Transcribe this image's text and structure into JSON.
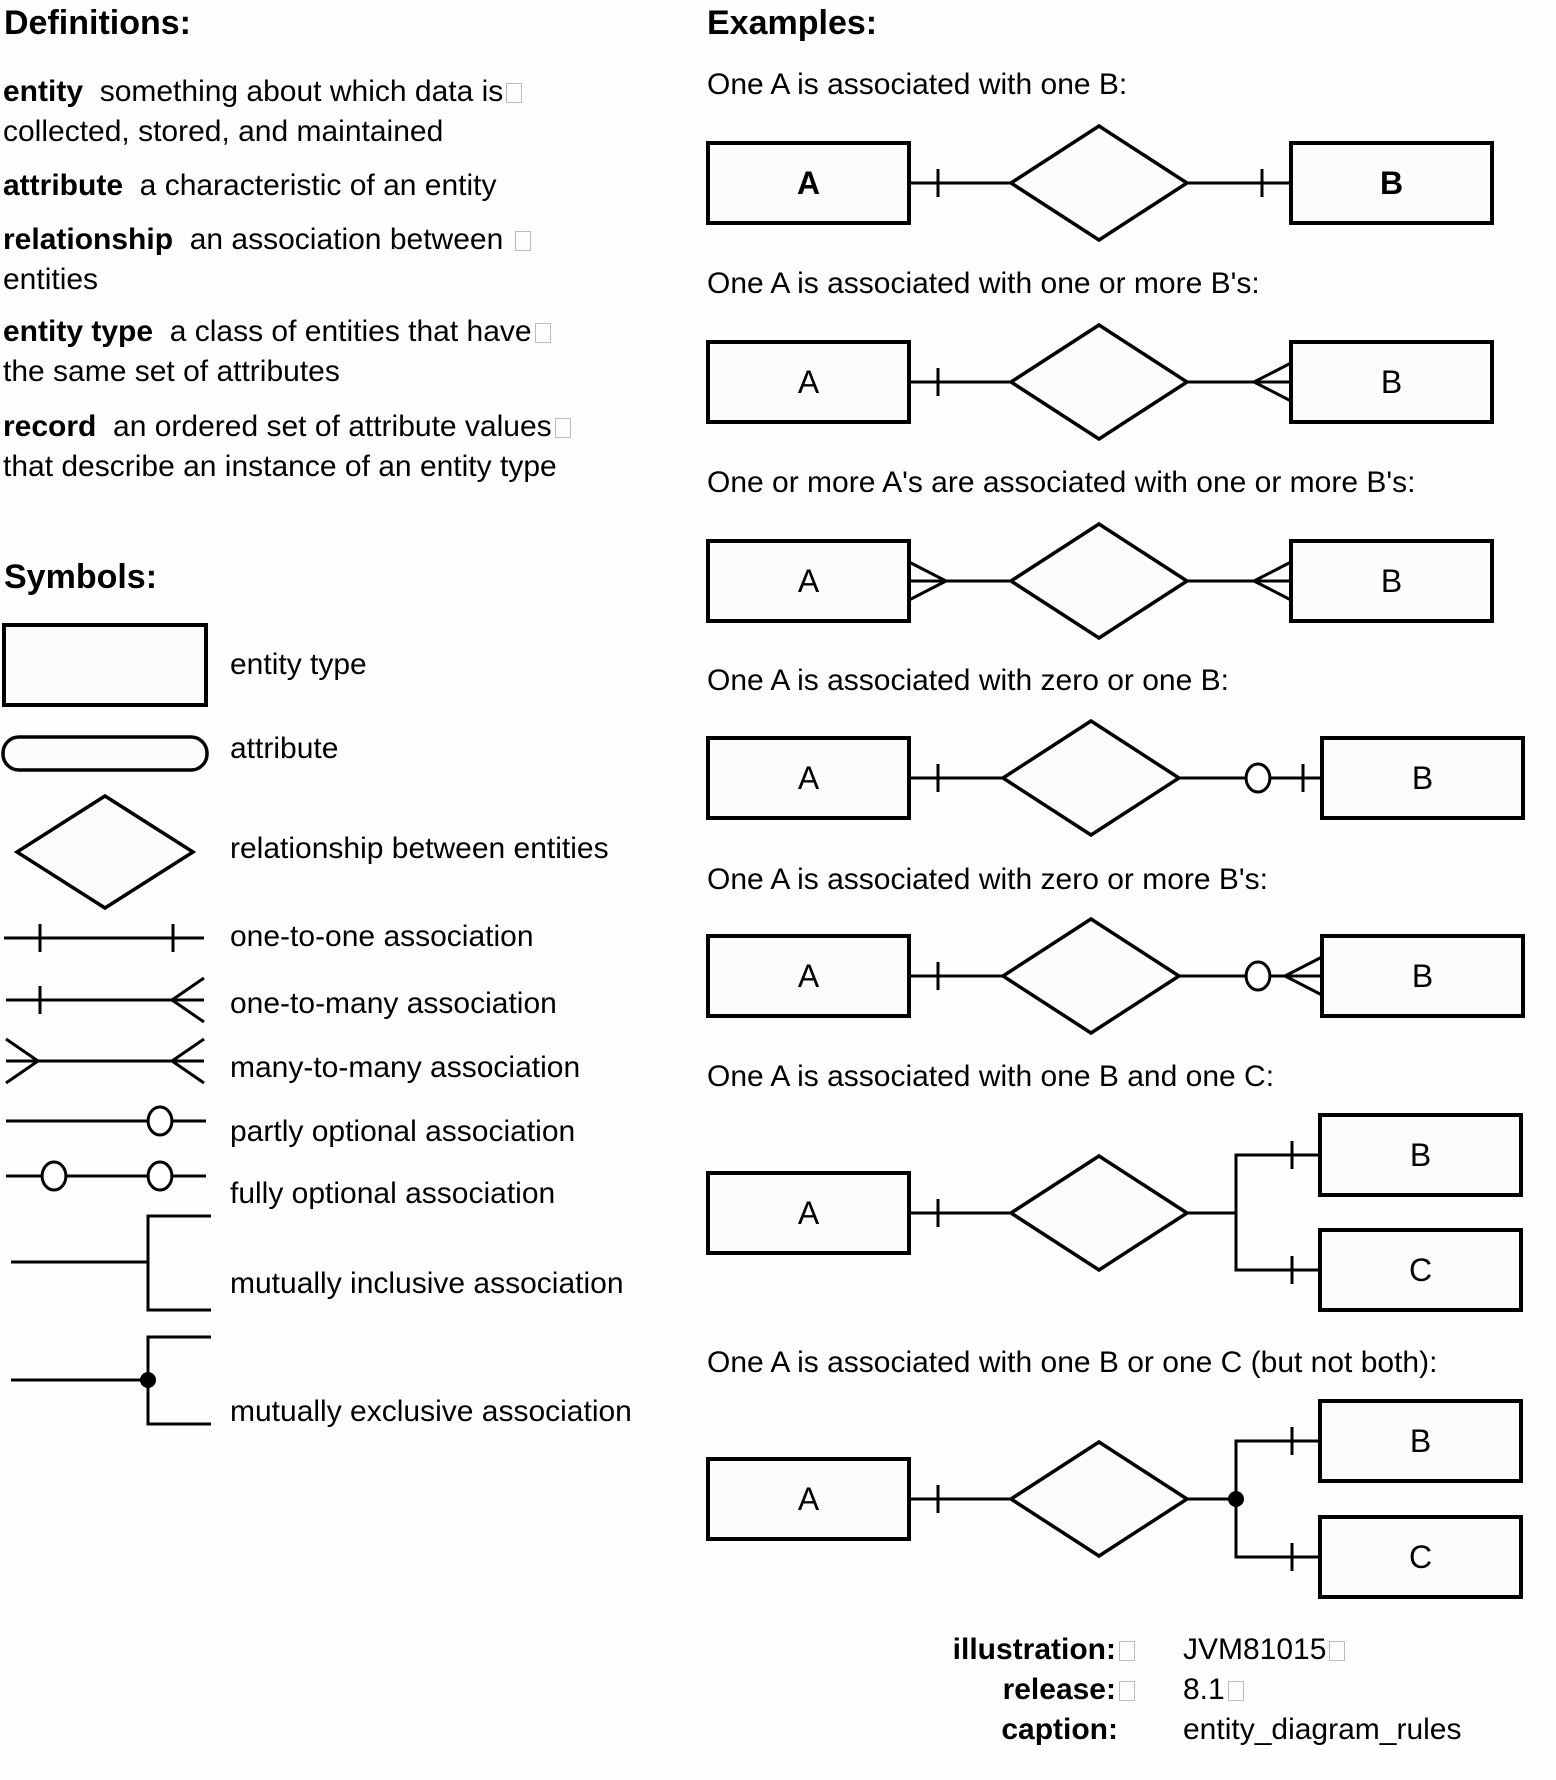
{
  "definitions": {
    "heading": "Definitions:",
    "items": [
      {
        "term": "entity",
        "text1": "something about which data is",
        "text2": "collected, stored, and maintained"
      },
      {
        "term": "attribute",
        "text1": "a characteristic of an entity",
        "text2": ""
      },
      {
        "term": "relationship",
        "text1": "an association between",
        "text2": "entities"
      },
      {
        "term": "entity type",
        "text1": "a class of entities that have",
        "text2": "the same set of attributes"
      },
      {
        "term": "record",
        "text1": "an ordered set of attribute values",
        "text2": "that describe an instance of an entity type"
      }
    ]
  },
  "symbols": {
    "heading": "Symbols:",
    "items": [
      {
        "symbol": "rectangle",
        "label": "entity type"
      },
      {
        "symbol": "rounded-rectangle",
        "label": "attribute"
      },
      {
        "symbol": "diamond",
        "label": "relationship between entities"
      },
      {
        "symbol": "one-to-one-line",
        "label": "one-to-one association"
      },
      {
        "symbol": "one-to-many-line",
        "label": "one-to-many association"
      },
      {
        "symbol": "many-to-many-line",
        "label": "many-to-many association"
      },
      {
        "symbol": "partly-optional-line",
        "label": "partly optional association"
      },
      {
        "symbol": "fully-optional-line",
        "label": "fully optional association"
      },
      {
        "symbol": "inclusive-bracket",
        "label": "mutually inclusive association"
      },
      {
        "symbol": "exclusive-bracket-dot",
        "label": "mutually exclusive association"
      }
    ]
  },
  "examples": {
    "heading": "Examples:",
    "items": [
      {
        "label": "One A is associated with one B:",
        "entities": [
          "A",
          "B"
        ],
        "left_end": "one",
        "right_end": "one",
        "bold_names": true
      },
      {
        "label": "One A is associated with one or more B's:",
        "entities": [
          "A",
          "B"
        ],
        "left_end": "one",
        "right_end": "many"
      },
      {
        "label": "One or more A's are associated with one or more B's:",
        "entities": [
          "A",
          "B"
        ],
        "left_end": "many",
        "right_end": "many"
      },
      {
        "label": "One A is associated with zero or one B:",
        "entities": [
          "A",
          "B"
        ],
        "left_end": "one",
        "right_end": "zero-or-one"
      },
      {
        "label": "One A is associated with zero or more B's:",
        "entities": [
          "A",
          "B"
        ],
        "left_end": "one",
        "right_end": "zero-or-many"
      },
      {
        "label": "One A is associated with one B and one C:",
        "entities": [
          "A",
          "B",
          "C"
        ],
        "left_end": "one",
        "right_end": "inclusive"
      },
      {
        "label": "One A is associated with one B or one C (but not both):",
        "entities": [
          "A",
          "B",
          "C"
        ],
        "left_end": "one",
        "right_end": "exclusive"
      }
    ]
  },
  "metadata": [
    {
      "key": "illustration:",
      "value": "JVM81015"
    },
    {
      "key": "release:",
      "value": "8.1"
    },
    {
      "key": "caption:",
      "value": "entity_diagram_rules"
    }
  ]
}
